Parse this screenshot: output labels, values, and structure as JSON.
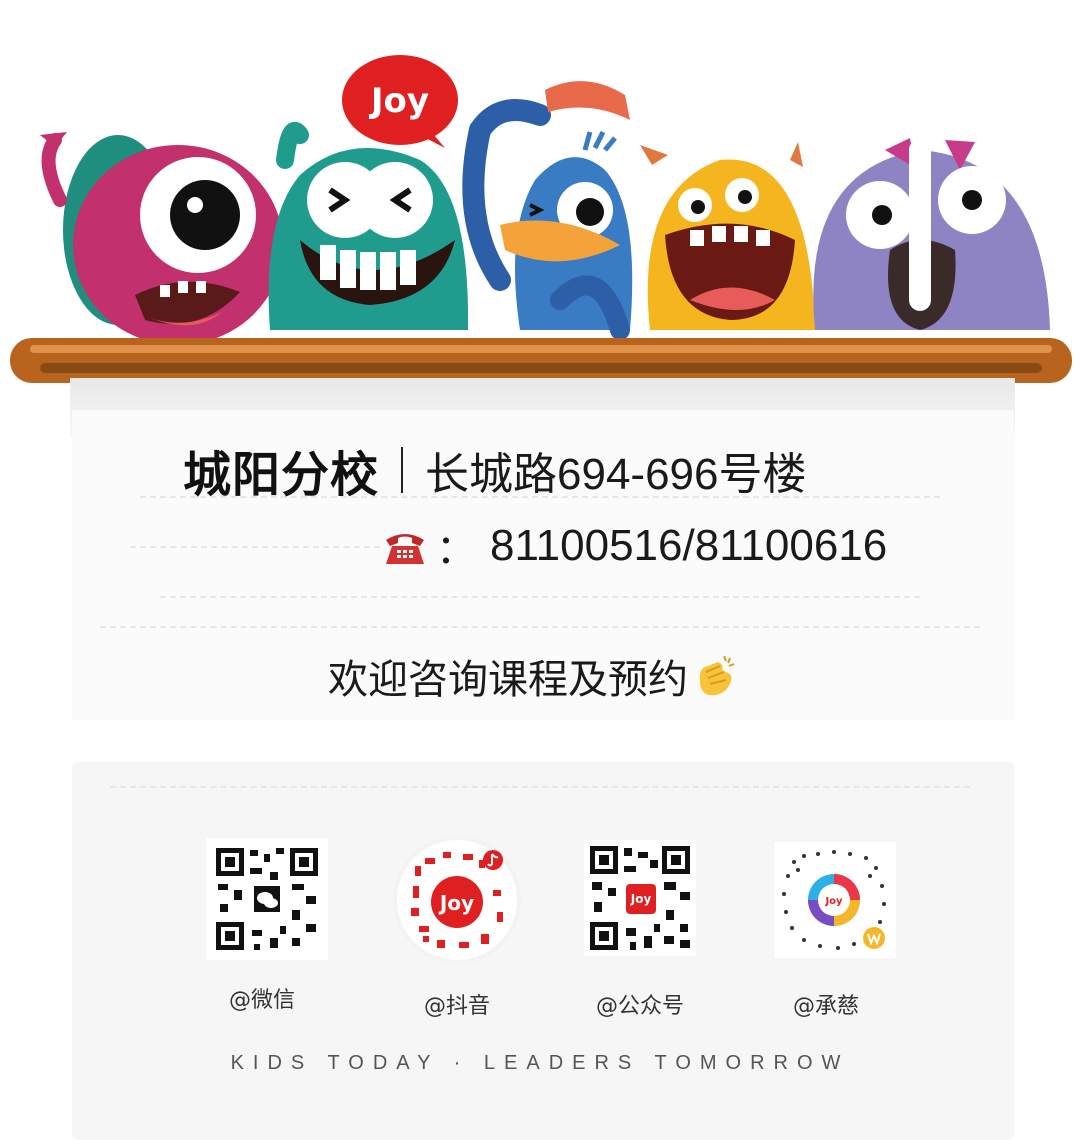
{
  "branch": {
    "name": "城阳分校",
    "address": "长城路694-696号楼"
  },
  "contact": {
    "colon": "：",
    "phone": "81100516/81100616",
    "phone_icon": "telephone-icon"
  },
  "welcome": {
    "text": "欢迎咨询课程及预约",
    "icon": "clapping-hands-icon"
  },
  "logo": {
    "text": "Joy",
    "color": "#e02020"
  },
  "social": [
    {
      "label": "@微信",
      "icon": "wechat-qr-code"
    },
    {
      "label": "@抖音",
      "icon": "douyin-qr-code"
    },
    {
      "label": "@公众号",
      "icon": "official-account-qr-code"
    },
    {
      "label": "@承慈",
      "icon": "chengci-qr-code"
    }
  ],
  "slogan": "KIDS TODAY · LEADERS TOMORROW",
  "colors": {
    "shelf": "#b8641e",
    "pink_monster": "#c2306e",
    "teal_monster": "#1f9c8e",
    "blue_monster": "#2d6fb8",
    "yellow_monster": "#f4b51f",
    "purple_monster": "#8e84c4",
    "accent_red": "#e02020"
  }
}
